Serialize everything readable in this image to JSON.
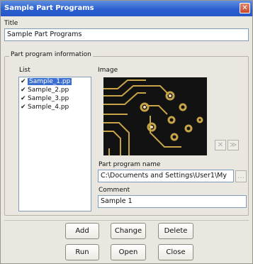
{
  "window": {
    "title": "Sample Part Programs",
    "close_glyph": "✕"
  },
  "title_section": {
    "label": "Title",
    "value": "Sample Part Programs"
  },
  "group": {
    "label": "Part program information"
  },
  "list": {
    "label": "List",
    "items": [
      {
        "label": "Sample_1.pp",
        "checked": true,
        "selected": true
      },
      {
        "label": "Sample_2.pp",
        "checked": true,
        "selected": false
      },
      {
        "label": "Sample_3.pp",
        "checked": true,
        "selected": false
      },
      {
        "label": "Sample_4.pp",
        "checked": true,
        "selected": false
      }
    ],
    "check_glyph": "✔"
  },
  "image": {
    "label": "Image",
    "delete_glyph": "✕",
    "next_glyph": "≫"
  },
  "part_program_name": {
    "label": "Part program name",
    "value": "C:\\Documents and Settings\\User1\\My",
    "browse_glyph": "…"
  },
  "comment": {
    "label": "Comment",
    "value": "Sample 1"
  },
  "buttons": {
    "add": "Add",
    "change": "Change",
    "delete": "Delete",
    "run": "Run",
    "open": "Open",
    "close": "Close"
  },
  "colors": {
    "titlebar": "#2b5fcf",
    "selection": "#3a6ed1",
    "pcb_trace": "#c8a448",
    "pcb_background": "#121212"
  }
}
